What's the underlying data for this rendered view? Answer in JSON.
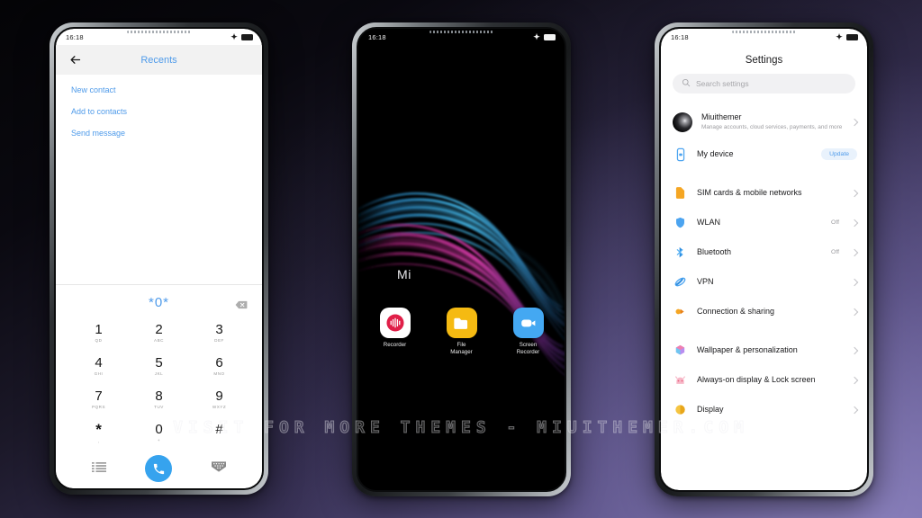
{
  "background": {
    "gradient_from": "#040406",
    "gradient_to": "#6b629a"
  },
  "watermark": {
    "text": "VISIT  FOR  MORE  THEMES  -  MIUITHEMER.COM"
  },
  "phone_left": {
    "statusbar": {
      "time": "16:18",
      "plus_icon": "airplane-plus-icon",
      "battery_icon": "battery-icon"
    },
    "header": {
      "back_icon": "back-arrow-icon",
      "title": "Recents"
    },
    "actions": [
      {
        "label": "New contact"
      },
      {
        "label": "Add to contacts"
      },
      {
        "label": "Send message"
      }
    ],
    "dialpad": {
      "display": "*0*",
      "backspace_icon": "backspace-icon",
      "keys": [
        {
          "digit": "1",
          "sub": "QD"
        },
        {
          "digit": "2",
          "sub": "ABC"
        },
        {
          "digit": "3",
          "sub": "DEF"
        },
        {
          "digit": "4",
          "sub": "GHI"
        },
        {
          "digit": "5",
          "sub": "JKL"
        },
        {
          "digit": "6",
          "sub": "MNO"
        },
        {
          "digit": "7",
          "sub": "PQRS"
        },
        {
          "digit": "8",
          "sub": "TUV"
        },
        {
          "digit": "9",
          "sub": "WXYZ"
        },
        {
          "digit": "*",
          "sub": ","
        },
        {
          "digit": "0",
          "sub": "+"
        },
        {
          "digit": "#",
          "sub": ""
        }
      ],
      "bottom": {
        "list_icon": "call-log-list-icon",
        "call_icon": "call-icon",
        "hide_keypad_icon": "hide-keypad-icon"
      }
    },
    "accent_color": "#4f9bea"
  },
  "phone_center": {
    "statusbar": {
      "time": "16:18",
      "plus_icon": "airplane-plus-icon",
      "battery_icon": "battery-icon"
    },
    "wallpaper_label": "Mi",
    "apps": [
      {
        "label": "Recorder",
        "icon": "recorder-icon"
      },
      {
        "label": "File\nManager",
        "label_line1": "File",
        "label_line2": "Manager",
        "icon": "file-manager-icon"
      },
      {
        "label": "Screen\nRecorder",
        "label_line1": "Screen",
        "label_line2": "Recorder",
        "icon": "screen-recorder-icon"
      }
    ]
  },
  "phone_right": {
    "statusbar": {
      "time": "16:18",
      "plus_icon": "airplane-plus-icon",
      "battery_icon": "battery-icon"
    },
    "title": "Settings",
    "search": {
      "placeholder": "Search settings",
      "icon": "search-icon"
    },
    "account": {
      "name": "Miuithemer",
      "subtitle": "Manage accounts, cloud services, payments, and more",
      "avatar": "user-avatar"
    },
    "my_device": {
      "label": "My device",
      "badge": "Update",
      "icon": "device-icon"
    },
    "items": [
      {
        "label": "SIM cards & mobile networks",
        "value": "",
        "icon": "sim-card-icon"
      },
      {
        "label": "WLAN",
        "value": "Off",
        "icon": "wlan-icon"
      },
      {
        "label": "Bluetooth",
        "value": "Off",
        "icon": "bluetooth-icon"
      },
      {
        "label": "VPN",
        "value": "",
        "icon": "vpn-icon"
      },
      {
        "label": "Connection & sharing",
        "value": "",
        "icon": "connection-sharing-icon"
      }
    ],
    "items2": [
      {
        "label": "Wallpaper & personalization",
        "value": "",
        "icon": "wallpaper-icon"
      },
      {
        "label": "Always-on display & Lock screen",
        "value": "",
        "icon": "aod-lockscreen-icon"
      },
      {
        "label": "Display",
        "value": "",
        "icon": "display-icon"
      }
    ]
  }
}
